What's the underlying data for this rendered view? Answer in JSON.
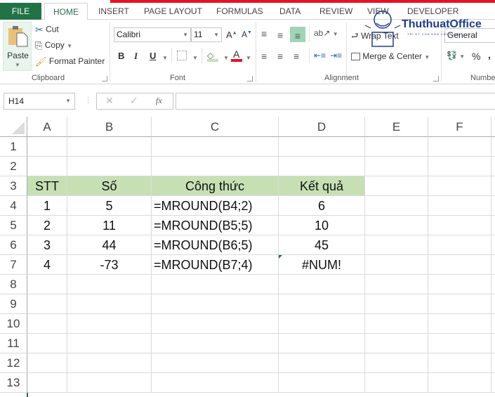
{
  "ribbon_tabs": [
    "FILE",
    "HOME",
    "INSERT",
    "PAGE LAYOUT",
    "FORMULAS",
    "DATA",
    "REVIEW",
    "VIEW",
    "DEVELOPER"
  ],
  "active_tab": "HOME",
  "clipboard": {
    "paste": "Paste",
    "cut": "Cut",
    "copy": "Copy",
    "format_painter": "Format Painter",
    "group_label": "Clipboard"
  },
  "font": {
    "name": "Calibri",
    "size": "11",
    "bold": "B",
    "italic": "I",
    "underline": "U",
    "group_label": "Font",
    "fill_color": "#c6e0b4",
    "font_color": "#e81123"
  },
  "alignment": {
    "wrap_text": "Wrap Text",
    "merge_center": "Merge & Center",
    "group_label": "Alignment"
  },
  "number": {
    "format": "General",
    "percent": "%",
    "comma": ",",
    "group_label": "Number"
  },
  "watermark": {
    "brand": "ThuthuatOffice",
    "tagline": "TRI KỶ CỦA DÂN CÔNG SỞ"
  },
  "formula_bar": {
    "name_box": "H14",
    "cancel": "✕",
    "enter": "✓",
    "fx": "fx",
    "value": ""
  },
  "sheet": {
    "columns": [
      "A",
      "B",
      "C",
      "D",
      "E",
      "F"
    ],
    "rows": [
      "1",
      "2",
      "3",
      "4",
      "5",
      "6",
      "7",
      "8",
      "9",
      "10",
      "11",
      "12",
      "13"
    ],
    "header_fill": "#c6e0b4",
    "table": {
      "headers": [
        "STT",
        "Số",
        "Công thức",
        "Kết quả"
      ],
      "rows": [
        [
          "1",
          "5",
          "=MROUND(B4;2)",
          "6"
        ],
        [
          "2",
          "11",
          "=MROUND(B5;5)",
          "10"
        ],
        [
          "3",
          "44",
          "=MROUND(B6;5)",
          "45"
        ],
        [
          "4",
          "-73",
          "=MROUND(B7;4)",
          "#NUM!"
        ]
      ]
    }
  }
}
